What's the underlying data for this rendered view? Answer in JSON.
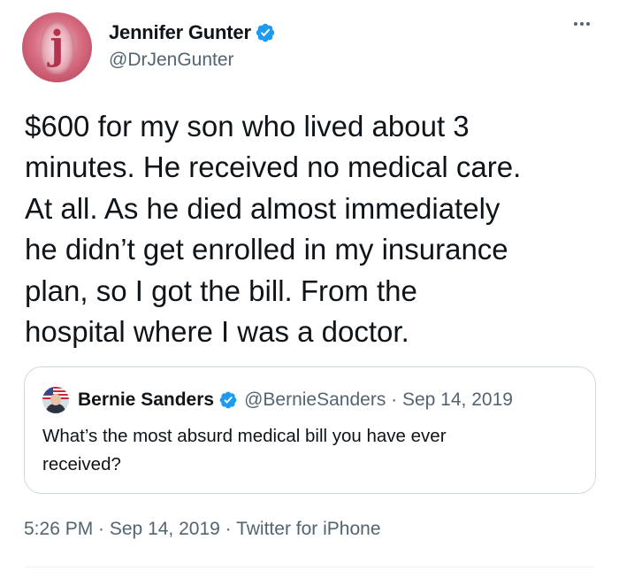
{
  "author": {
    "display_name": "Jennifer Gunter",
    "handle": "@DrJenGunter",
    "avatar_letter": "j",
    "verified_icon": "verified-badge-icon"
  },
  "tweet": {
    "text_lines": [
      "$600 for my son who lived about 3",
      "minutes. He received no medical care.",
      "At all. As he died almost immediately",
      "he didn’t get enrolled in my insurance",
      "plan, so I got the bill.  From the",
      "hospital where I was a doctor."
    ]
  },
  "quote": {
    "display_name": "Bernie Sanders",
    "meta": "@BernieSanders · Sep 14, 2019",
    "text_lines": [
      "What’s the most absurd medical bill you have ever",
      "received?"
    ]
  },
  "footer": {
    "timestamp": "5:26 PM · Sep 14, 2019 · Twitter for iPhone"
  },
  "colors": {
    "verified_blue": "#1d9bf0",
    "text_primary": "#0f1419",
    "text_secondary": "#536471",
    "border": "#cfd9de"
  }
}
